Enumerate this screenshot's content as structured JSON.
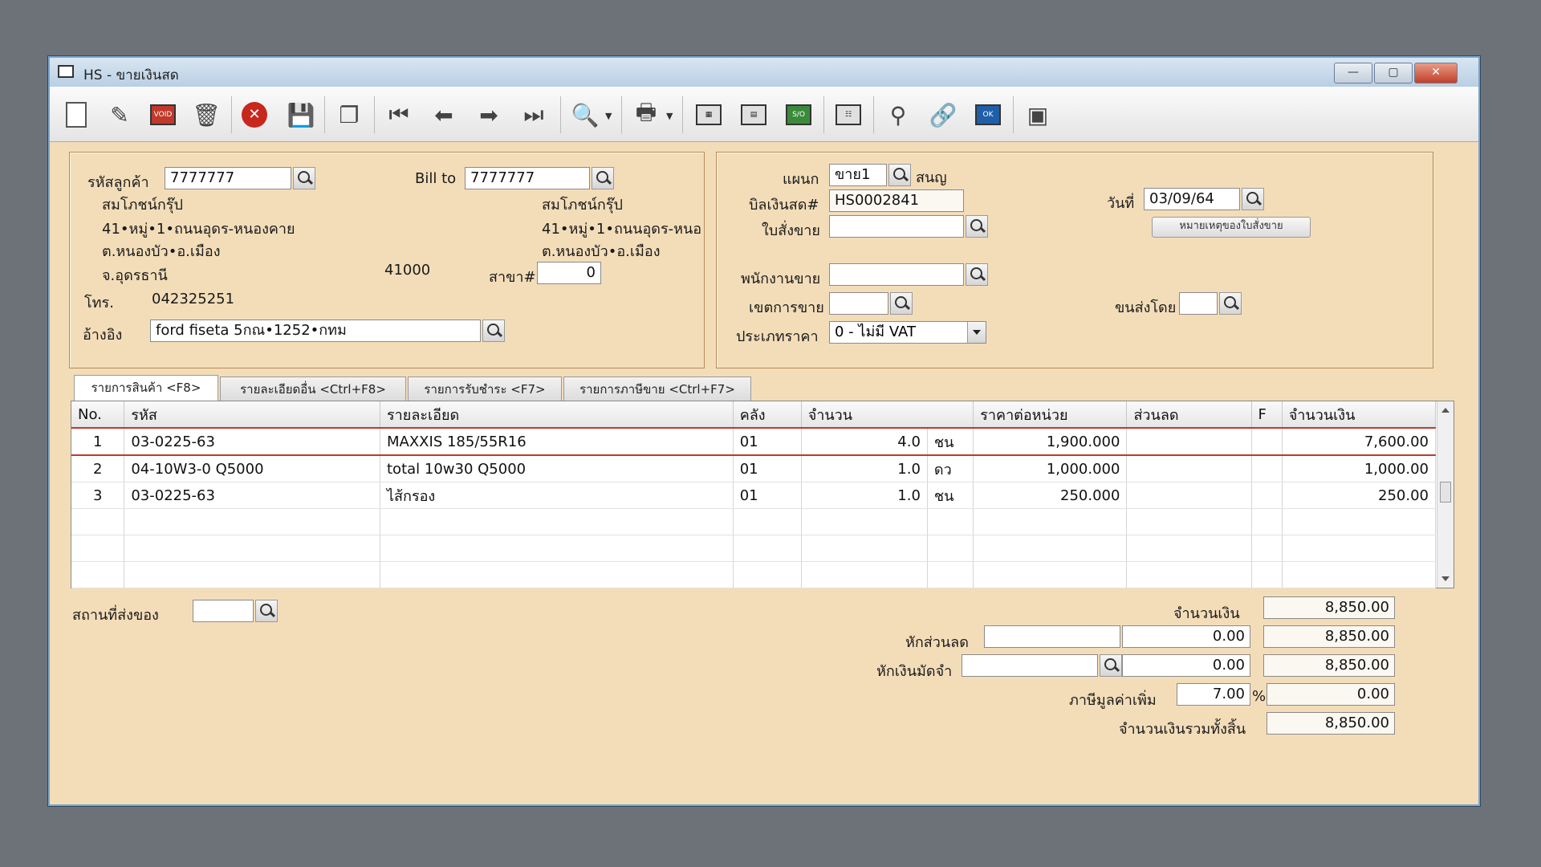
{
  "window": {
    "title": "HS - ขายเงินสด",
    "min": "—",
    "max": "▢",
    "close": "✕"
  },
  "toolbar": {
    "icons": [
      "new-icon",
      "edit-icon",
      "void-icon",
      "delete-icon",
      "cancel-icon",
      "save-icon",
      "copy-icon",
      "first-icon",
      "prev-icon",
      "next-icon",
      "last-icon",
      "search-doc-icon",
      "print-icon",
      "report-icon",
      "calc-icon",
      "so-icon",
      "statement-icon",
      "approve-icon",
      "link-icon",
      "ok-icon",
      "export-icon"
    ],
    "void_label": "VOID",
    "so_label": "S/O",
    "ok_label": "OK"
  },
  "customer": {
    "code_label": "รหัสลูกค้า",
    "code": "7777777",
    "name": "สมโภชน์กรุ๊ป",
    "addr1": "41•หมู่•1•ถนนอุดร-หนองคาย",
    "addr2": "ต.หนองบัว•อ.เมือง",
    "addr3": "จ.อุดรธานี",
    "zip": "41000",
    "tel_label": "โทร.",
    "tel": "042325251",
    "ref_label": "อ้างอิง",
    "ref": "ford fiseta 5กณ•1252•กทม"
  },
  "billto": {
    "label": "Bill to",
    "code": "7777777",
    "name": "สมโภชน์กรุ๊ป",
    "addr1": "41•หมู่•1•ถนนอุดร-หนอ",
    "addr2": "ต.หนองบัว•อ.เมือง",
    "branch_label": "สาขา#",
    "branch": "0"
  },
  "doc": {
    "dept_label": "แผนก",
    "dept": "ขาย1",
    "dept_name": "สนญ",
    "bill_label": "บิลเงินสด#",
    "bill": "HS0002841",
    "date_label": "วันที่",
    "date": "03/09/64",
    "so_label": "ใบสั่งขาย",
    "so": "",
    "so_note_button": "หมายเหตุของใบสั่งขาย",
    "salesman_label": "พนักงานขาย",
    "salesman": "",
    "area_label": "เขตการขาย",
    "area": "",
    "ship_label": "ขนส่งโดย",
    "ship": "",
    "price_type_label": "ประเภทราคา",
    "price_type": "0 - ไม่มี VAT"
  },
  "tabs": [
    {
      "label": "รายการสินค้า <F8>"
    },
    {
      "label": "รายละเอียดอื่น <Ctrl+F8>"
    },
    {
      "label": "รายการรับชำระ <F7>"
    },
    {
      "label": "รายการภาษีขาย <Ctrl+F7>"
    }
  ],
  "grid": {
    "headers": {
      "no": "No.",
      "code": "รหัส",
      "desc": "รายละเอียด",
      "wh": "คลัง",
      "qty": "จำนวน",
      "price": "ราคาต่อหน่วย",
      "disc": "ส่วนลด",
      "f": "F",
      "amount": "จำนวนเงิน"
    },
    "rows": [
      {
        "no": "1",
        "code": "03-0225-63",
        "desc": "MAXXIS 185/55R16",
        "wh": "01",
        "qty": "4.0",
        "unit": "ชน",
        "price": "1,900.000",
        "disc": "",
        "f": "",
        "amount": "7,600.00"
      },
      {
        "no": "2",
        "code": "04-10W3-0 Q5000",
        "desc": "total 10w30 Q5000",
        "wh": "01",
        "qty": "1.0",
        "unit": "ดว",
        "price": "1,000.000",
        "disc": "",
        "f": "",
        "amount": "1,000.00"
      },
      {
        "no": "3",
        "code": "03-0225-63",
        "desc": "ไส้กรอง",
        "wh": "01",
        "qty": "1.0",
        "unit": "ชน",
        "price": "250.000",
        "disc": "",
        "f": "",
        "amount": "250.00"
      }
    ]
  },
  "footer": {
    "delivery_label": "สถานที่ส่งของ",
    "delivery": "",
    "amount_label": "จำนวนเงิน",
    "amount": "8,850.00",
    "discount_label": "หักส่วนลด",
    "discount_code": "",
    "discount_value": "0.00",
    "after_discount": "8,850.00",
    "deposit_label": "หักเงินมัดจำ",
    "deposit_code": "",
    "deposit_value": "0.00",
    "after_deposit": "8,850.00",
    "vat_label": "ภาษีมูลค่าเพิ่ม",
    "vat_rate": "7.00",
    "vat_pct": "%",
    "vat_amount": "0.00",
    "total_label": "จำนวนเงินรวมทั้งสิ้น",
    "total": "8,850.00"
  }
}
